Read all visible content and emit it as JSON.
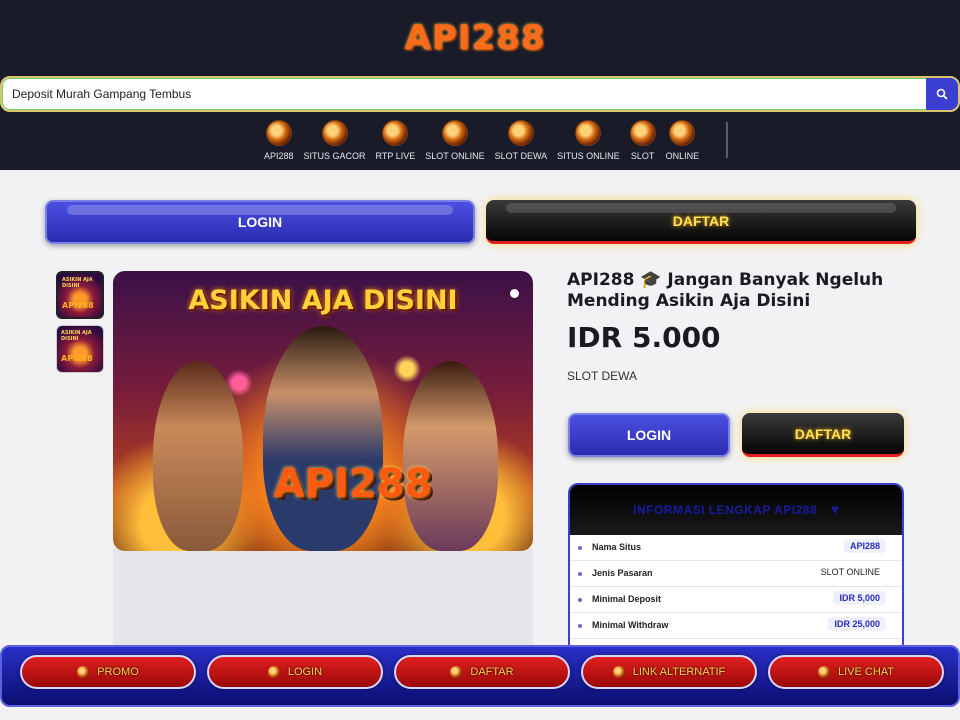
{
  "header": {
    "logo_text": "API288",
    "search": {
      "value": "Deposit Murah Gampang Tembus",
      "icon": "search-icon"
    },
    "nav": [
      {
        "label": "API288"
      },
      {
        "label": "SITUS GACOR"
      },
      {
        "label": "RTP LIVE"
      },
      {
        "label": "SLOT ONLINE"
      },
      {
        "label": "SLOT DEWA"
      },
      {
        "label": "SITUS ONLINE"
      },
      {
        "label": "SLOT"
      },
      {
        "label": "ONLINE"
      }
    ]
  },
  "actions": {
    "login_label": "LOGIN",
    "daftar_label": "DAFTAR"
  },
  "gallery": {
    "hero_title": "ASIKIN AJA DISINI",
    "hero_logo": "API288",
    "thumb_title": "ASIKIN AJA DISINI",
    "thumb_logo": "API288"
  },
  "product": {
    "title": "API288 🎓 Jangan Banyak Ngeluh Mending Asikin Aja Disini",
    "price": "IDR 5.000",
    "category": "SLOT DEWA"
  },
  "info": {
    "heading": "INFORMASI LENGKAP API288",
    "rows": [
      {
        "label": "Nama Situs",
        "value": "API288"
      },
      {
        "label": "Jenis Pasaran",
        "value": "SLOT ONLINE"
      },
      {
        "label": "Minimal Deposit",
        "value": "IDR 5,000"
      },
      {
        "label": "Minimal Withdraw",
        "value": "IDR 25,000"
      }
    ]
  },
  "bottom_bar": [
    {
      "label": "PROMO"
    },
    {
      "label": "LOGIN"
    },
    {
      "label": "DAFTAR"
    },
    {
      "label": "LINK ALTERNATIF"
    },
    {
      "label": "LIVE CHAT"
    }
  ],
  "colors": {
    "header_bg": "#1a1b29",
    "accent_blue": "#3b3fd1",
    "accent_red": "#e51e1e",
    "gold": "#ffe25a"
  }
}
